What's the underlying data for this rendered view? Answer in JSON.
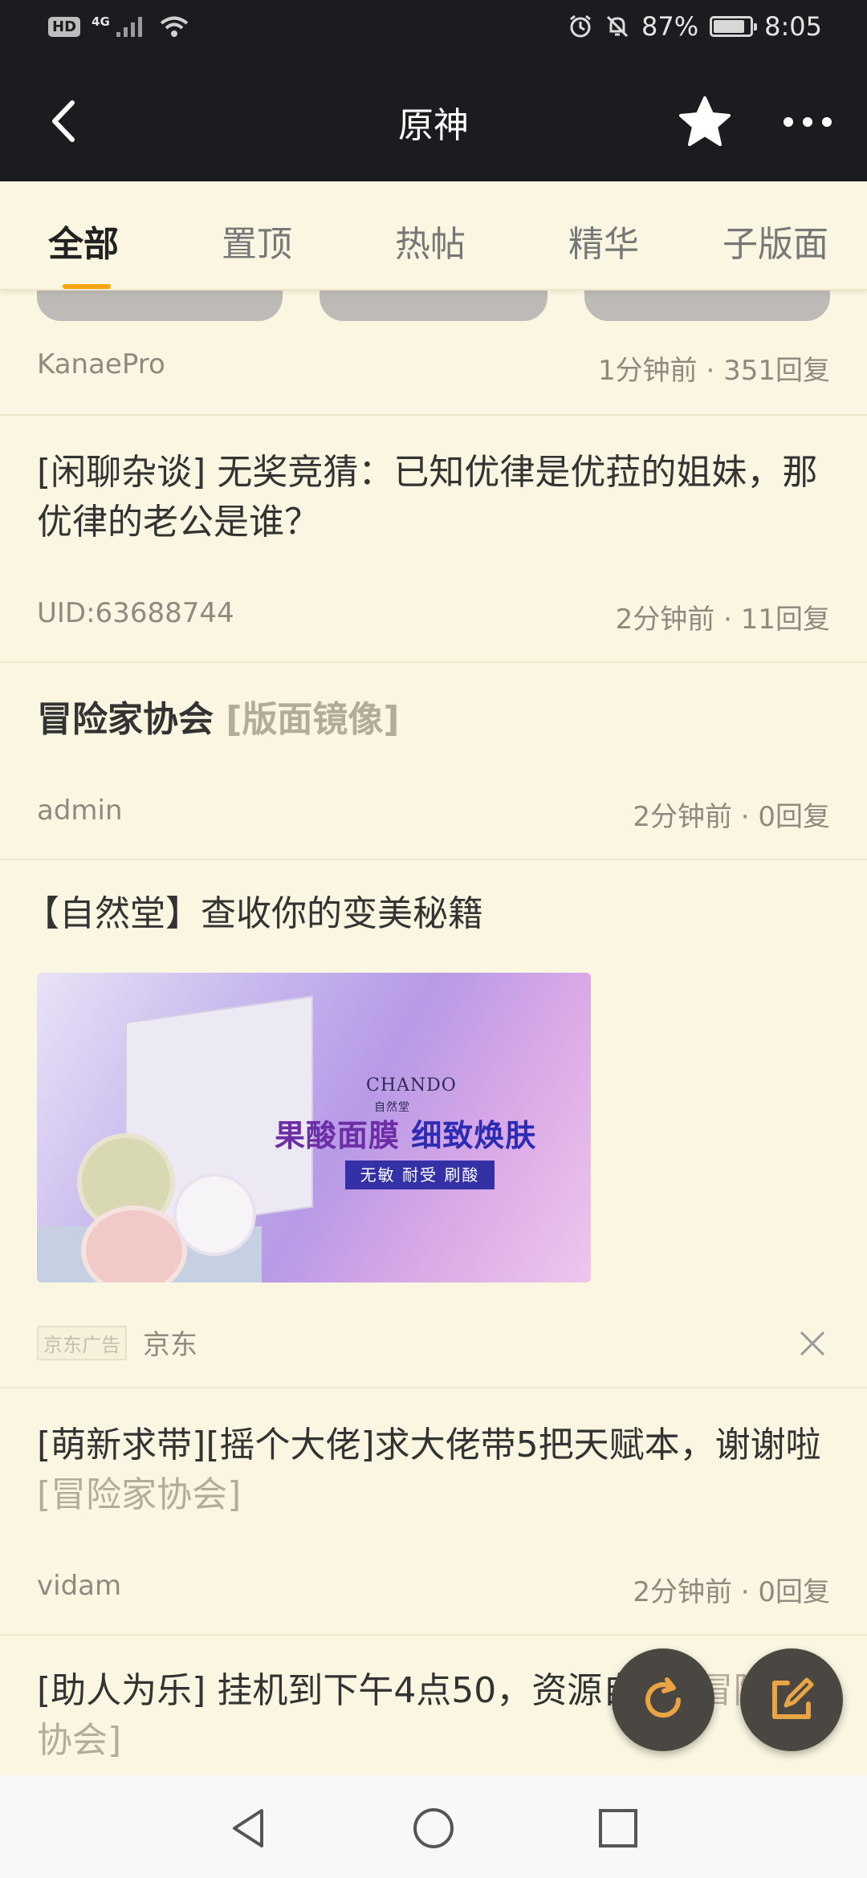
{
  "status_bar": {
    "hd": "HD",
    "network": "4G",
    "battery_percent": "87%",
    "battery_level": 0.87,
    "time": "8:05",
    "icons": [
      "signal-icon",
      "wifi-icon",
      "alarm-icon",
      "mute-icon",
      "battery-icon"
    ]
  },
  "header": {
    "title": "原神",
    "icons": [
      "back-icon",
      "star-icon",
      "more-icon"
    ]
  },
  "tabs": [
    {
      "label": "全部",
      "active": true
    },
    {
      "label": "置顶",
      "active": false
    },
    {
      "label": "热帖",
      "active": false
    },
    {
      "label": "精华",
      "active": false
    },
    {
      "label": "子版面",
      "active": false
    }
  ],
  "accent_color": "#f7a516",
  "posts": [
    {
      "title": "",
      "author": "KanaePro",
      "meta": "1分钟前 · 351回复"
    },
    {
      "title": "[闲聊杂谈] 无奖竞猜：已知优律是优菈的姐妹，那优律的老公是谁？",
      "author": "UID:63688744",
      "meta": "2分钟前 · 11回复"
    },
    {
      "title": "冒险家协会",
      "tag": "[版面镜像]",
      "author": "admin",
      "meta": "2分钟前 · 0回复"
    },
    {
      "title": "[萌新求带][摇个大佬]求大佬带5把天赋本，谢谢啦",
      "tag": "[冒险家协会]",
      "author": "vidam",
      "meta": "2分钟前 · 0回复"
    },
    {
      "title": "[助人为乐] 挂机到下午4点50，资源自取",
      "tag": "[冒险家协会]"
    }
  ],
  "ad": {
    "title": "【自然堂】查收你的变美秘籍",
    "brand": "CHANDO",
    "brand_cn": "自然堂",
    "headline_1": "果酸面膜",
    "headline_2": "细致焕肤",
    "sub": "无敏 耐受 刷酸",
    "label": "京东广告",
    "source": "京东"
  },
  "fabs": [
    "refresh-icon",
    "compose-icon"
  ],
  "nav": [
    "nav-back-icon",
    "nav-home-icon",
    "nav-recents-icon"
  ]
}
